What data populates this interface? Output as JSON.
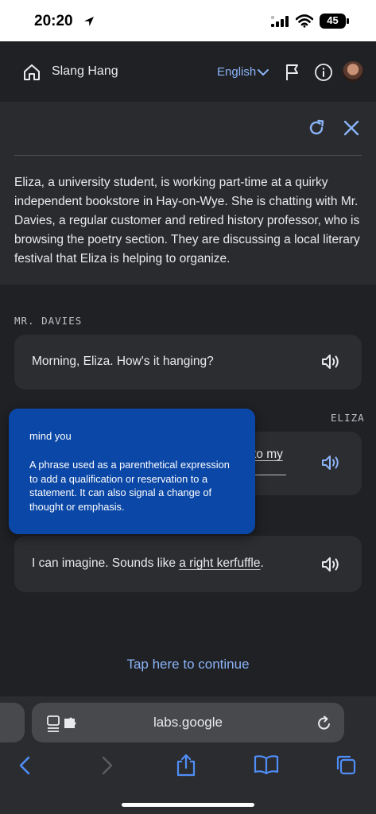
{
  "status_bar": {
    "time": "20:20",
    "battery": "45"
  },
  "header": {
    "title": "Slang Hang",
    "language": "English"
  },
  "scenario_text": "Eliza, a university student, is working part-time at a quirky independent bookstore in Hay-on-Wye. She is chatting with Mr. Davies, a regular customer and retired history professor, who is browsing the poetry section. They are discussing a local literary festival that Eliza is helping to organize.",
  "conversation": [
    {
      "speaker": "MR. DAVIES",
      "text": "Morning, Eliza. How's it hanging?"
    },
    {
      "speaker": "ELIZA",
      "visible_fragment": "to my"
    },
    {
      "text_before": "I can imagine. Sounds like ",
      "link": "a right kerfuffle",
      "text_after": "."
    }
  ],
  "tooltip": {
    "term": "mind you",
    "definition": "A phrase used as a parenthetical expression to add a qualification or reservation to a statement. It can also signal a change of thought or emphasis."
  },
  "continue_label": "Tap here to continue",
  "browser": {
    "url": "labs.google"
  },
  "colors": {
    "accent": "#8ab4f8",
    "tooltip_bg": "#0b47a6",
    "background": "#202124"
  }
}
